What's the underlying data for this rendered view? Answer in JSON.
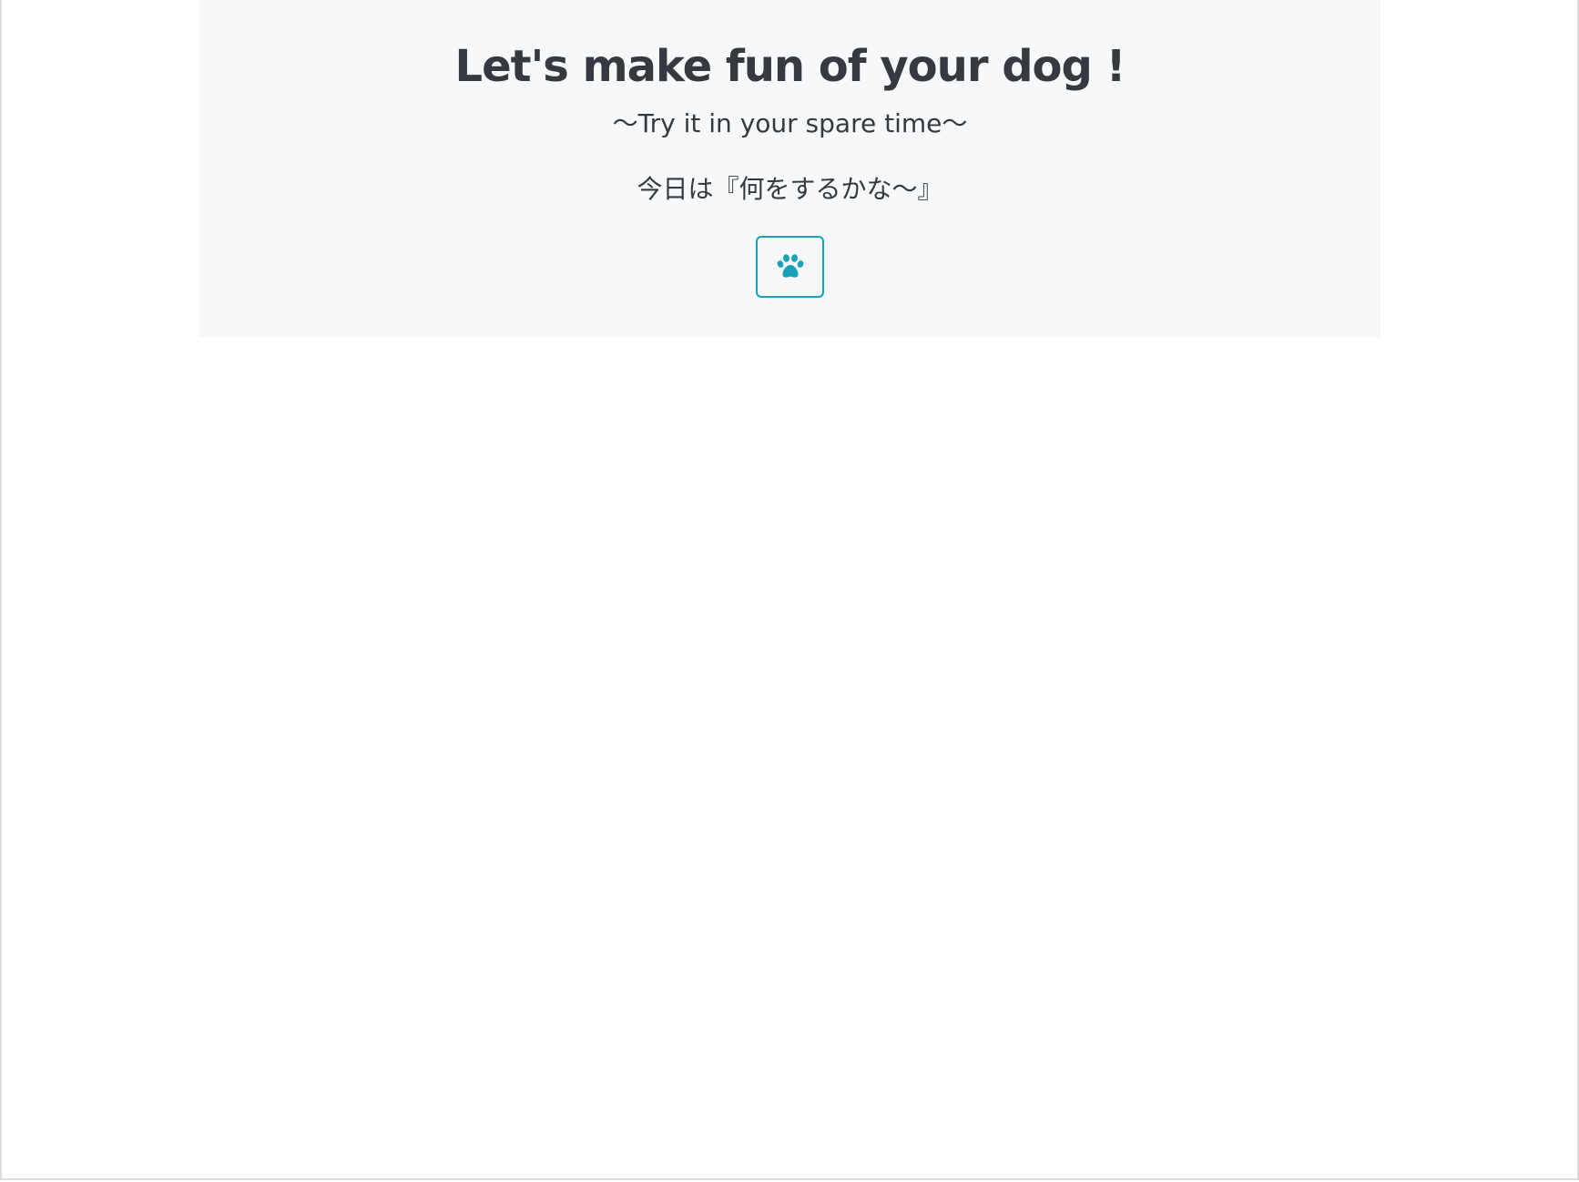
{
  "hero": {
    "title": "Let's make fun of your dog !",
    "subtitle": "〜Try it in your spare time〜",
    "message": "今日は『何をするかな〜』"
  },
  "action_button": {
    "icon": "paw-icon",
    "color": "#17a2b8"
  },
  "colors": {
    "hero_background": "#f7f8fa",
    "text": "#343a40",
    "accent": "#17a2b8"
  }
}
